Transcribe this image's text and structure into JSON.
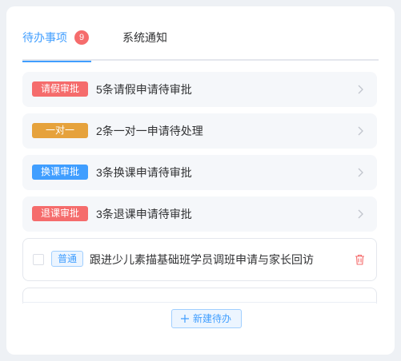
{
  "tabs": {
    "todo": {
      "label": "待办事项",
      "badge": "9"
    },
    "notice": {
      "label": "系统通知"
    }
  },
  "approvals": [
    {
      "tag": "请假审批",
      "tag_color": "#f56c6c",
      "text": "5条请假申请待审批"
    },
    {
      "tag": "一对一",
      "tag_color": "#e6a23c",
      "text": "2条一对一申请待处理"
    },
    {
      "tag": "换课审批",
      "tag_color": "#409eff",
      "text": "3条换课申请待审批"
    },
    {
      "tag": "退课审批",
      "tag_color": "#f56c6c",
      "text": "3条退课申请待审批"
    }
  ],
  "todos": [
    {
      "tag": "普通",
      "text": "跟进少儿素描基础班学员调班申请与家长回访",
      "checked": false
    }
  ],
  "new_button": {
    "label": "新建待办"
  },
  "colors": {
    "accent": "#409eff",
    "danger": "#f56c6c",
    "warning": "#e6a23c"
  }
}
